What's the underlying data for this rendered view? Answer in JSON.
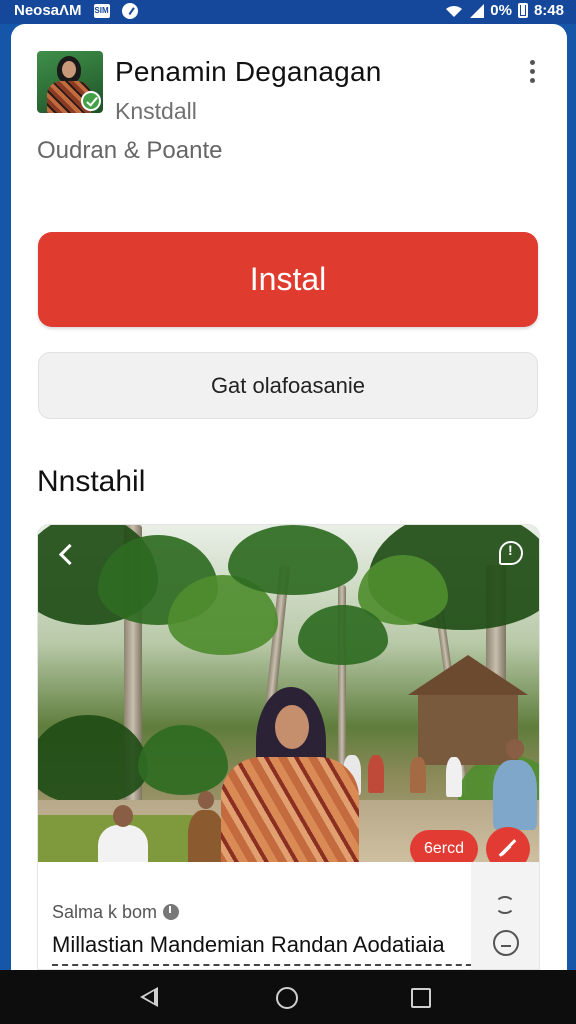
{
  "status_bar": {
    "carrier": "NeosaΛM",
    "battery": "0%",
    "time": "8:48",
    "icons": [
      "sim-card-icon",
      "check-circle-icon",
      "wifi-icon",
      "signal-icon",
      "battery-icon"
    ]
  },
  "app": {
    "title": "Penamin Deganagan",
    "developer": "Knstdall",
    "category": "Oudran & Poante",
    "icon": "app-icon"
  },
  "actions": {
    "install_label": "Instal",
    "secondary_label": "Gat olafoasanie",
    "install_color": "#df3b2f"
  },
  "section": {
    "title": "Nnstahil"
  },
  "media": {
    "pill_label": "6ercd",
    "author": "Salma k bom",
    "caption": "Millastian Mandemian Randan Aodatiaia"
  },
  "nav": {
    "icons": [
      "back-icon",
      "home-icon",
      "recents-icon"
    ]
  }
}
